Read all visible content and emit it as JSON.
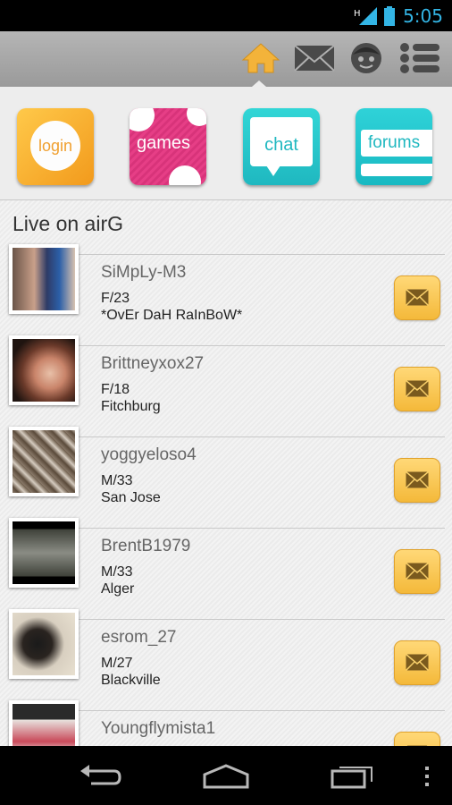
{
  "status_bar": {
    "time": "5:05",
    "network": "H"
  },
  "top_bar": {
    "icons": [
      "home-icon",
      "mail-icon",
      "profile-face-icon",
      "menu-list-icon"
    ]
  },
  "tiles": [
    {
      "label": "login",
      "color": "#f5a623"
    },
    {
      "label": "games",
      "color": "#e63e86"
    },
    {
      "label": "chat",
      "color": "#2cc9cc"
    },
    {
      "label": "forums",
      "color": "#2cc9cc"
    }
  ],
  "section_title": "Live on airG",
  "users": [
    {
      "name": "SiMpLy-M3",
      "line1": "F/23",
      "line2": "*OvEr DaH RaInBoW*"
    },
    {
      "name": "Brittneyxox27",
      "line1": "F/18",
      "line2": "Fitchburg"
    },
    {
      "name": "yoggyeloso4",
      "line1": "M/33",
      "line2": "San Jose"
    },
    {
      "name": "BrentB1979",
      "line1": "M/33",
      "line2": "Alger"
    },
    {
      "name": "esrom_27",
      "line1": "M/27",
      "line2": "Blackville"
    },
    {
      "name": "Youngflymista1",
      "line1": "",
      "line2": ""
    }
  ],
  "nav_bar": {
    "icons": [
      "back-icon",
      "home-icon",
      "recent-apps-icon",
      "overflow-menu-icon"
    ]
  }
}
